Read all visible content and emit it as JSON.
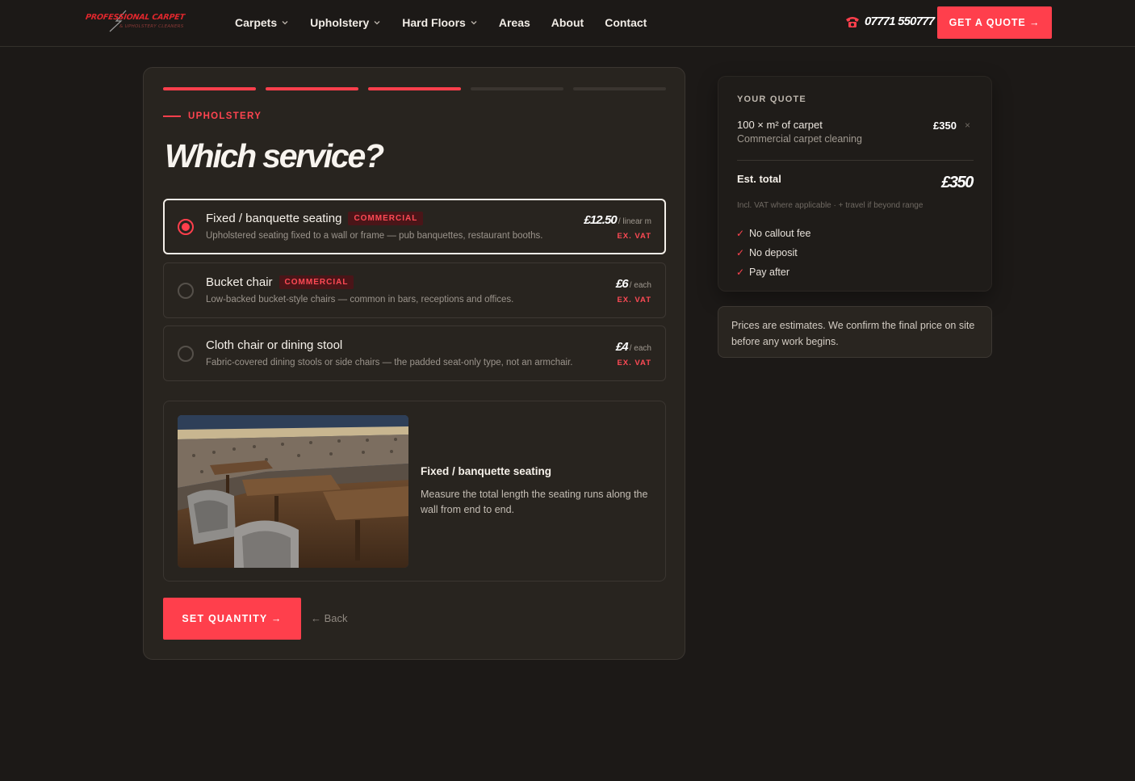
{
  "header": {
    "logo_main": "Professional Carpet",
    "logo_sub": "& Upholstery Cleaners",
    "nav": [
      {
        "label": "Carpets",
        "has_dropdown": true
      },
      {
        "label": "Upholstery",
        "has_dropdown": true
      },
      {
        "label": "Hard Floors",
        "has_dropdown": true
      },
      {
        "label": "Areas",
        "has_dropdown": false
      },
      {
        "label": "About",
        "has_dropdown": false
      },
      {
        "label": "Contact",
        "has_dropdown": false
      }
    ],
    "phone": "07771 550777",
    "phone_icon": "phone-icon",
    "quote_button": "GET A QUOTE →"
  },
  "wizard": {
    "progress": {
      "total_steps": 5,
      "completed_steps": 3
    },
    "eyebrow": "UPHOLSTERY",
    "title": "Which service?",
    "options": [
      {
        "name": "Fixed / banquette seating",
        "badge": "COMMERCIAL",
        "description": "Upholstered seating fixed to a wall or frame — pub banquettes, restaurant booths.",
        "price": "£12.50",
        "unit": "/ linear m",
        "vat": "EX. VAT",
        "selected": true
      },
      {
        "name": "Bucket chair",
        "badge": "COMMERCIAL",
        "description": "Low-backed bucket-style chairs — common in bars, receptions and offices.",
        "price": "£6",
        "unit": "/ each",
        "vat": "EX. VAT",
        "selected": false
      },
      {
        "name": "Cloth chair or dining stool",
        "badge": "",
        "description": "Fabric-covered dining stools or side chairs — the padded seat-only type, not an armchair.",
        "price": "£4",
        "unit": "/ each",
        "vat": "EX. VAT",
        "selected": false
      }
    ],
    "info": {
      "title": "Fixed / banquette seating",
      "text": "Measure the total length the seating runs along the wall from end to end."
    },
    "next_button": "SET QUANTITY →",
    "back_link": "← Back"
  },
  "quote": {
    "heading": "YOUR QUOTE",
    "line_title": "100 × m² of carpet",
    "line_subtitle": "Commercial carpet cleaning",
    "line_amount": "£350",
    "remove": "×",
    "est_label": "Est. total",
    "est_total": "£350",
    "note": "Incl. VAT where applicable · + travel if beyond range",
    "checks": [
      "No callout fee",
      "No deposit",
      "Pay after"
    ],
    "tick": "✓"
  },
  "disclaimer": "Prices are estimates. We confirm the final price on site before any work begins.",
  "colors": {
    "accent": "#ff3f4c",
    "background": "#1c1917",
    "card": "#28241f"
  }
}
